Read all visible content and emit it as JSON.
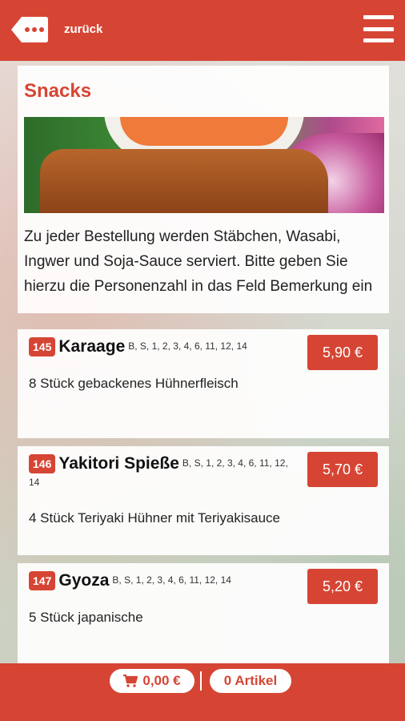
{
  "header": {
    "back_label": "zurück"
  },
  "section": {
    "title": "Snacks",
    "intro": "Zu jeder Bestellung werden Stäbchen, Wasabi, Ingwer und Soja-Sauce serviert. Bitte geben Sie hierzu die Personenzahl in das Feld Bemerkung ein"
  },
  "items": [
    {
      "number": "145",
      "name": "Karaage",
      "allergens": "B, S, 1, 2, 3, 4, 6, 11, 12, 14",
      "description": "8 Stück gebackenes Hühnerfleisch",
      "price": "5,90 €"
    },
    {
      "number": "146",
      "name": "Yakitori Spieße",
      "allergens": "B, S, 1, 2, 3, 4, 6, 11, 12, 14",
      "description": "4 Stück Teriyaki Hühner mit Teriyakisauce",
      "price": "5,70 €"
    },
    {
      "number": "147",
      "name": "Gyoza",
      "allergens": "B, S, 1, 2, 3, 4, 6, 11, 12, 14",
      "description": "5 Stück japanische",
      "price": "5,20 €"
    }
  ],
  "footer": {
    "cart_total": "0,00 €",
    "item_count": "0 Artikel"
  },
  "colors": {
    "accent": "#d64534"
  },
  "icons": {
    "back": "back-dots-icon",
    "menu": "hamburger-icon",
    "cart": "cart-icon"
  }
}
